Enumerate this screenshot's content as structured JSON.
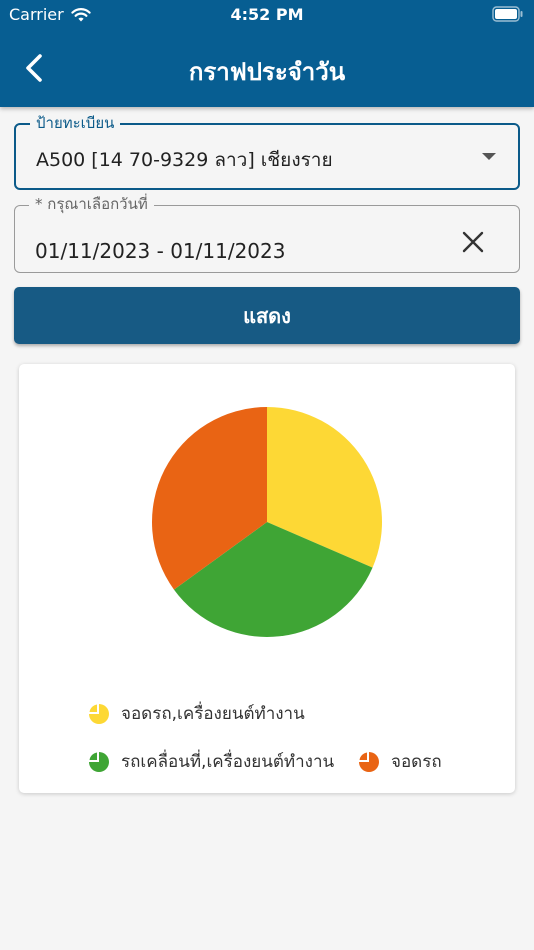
{
  "status_bar": {
    "carrier": "Carrier",
    "time": "4:52 PM"
  },
  "header": {
    "title": "กราฟประจำวัน",
    "back_icon": "chevron-left-icon"
  },
  "form": {
    "plate": {
      "label": "ป้ายทะเบียน",
      "value": "A500 [14 70-9329 ลาว] เชียงราย"
    },
    "date": {
      "label": "* กรุณาเลือกวันที่",
      "value": "01/11/2023 - 01/11/2023"
    },
    "show_button": "แสดง"
  },
  "chart_data": {
    "type": "pie",
    "title": "",
    "slices": [
      {
        "label": "จอดรถ,เครื่องยนต์ทำงาน",
        "value": 31.5,
        "color": "#fdd835"
      },
      {
        "label": "รถเคลื่อนที่,เครื่องยนต์ทำงาน",
        "value": 33.5,
        "color": "#3fa535"
      },
      {
        "label": "จอดรถ",
        "value": 35.0,
        "color": "#e96414"
      }
    ],
    "legend_position": "bottom"
  }
}
